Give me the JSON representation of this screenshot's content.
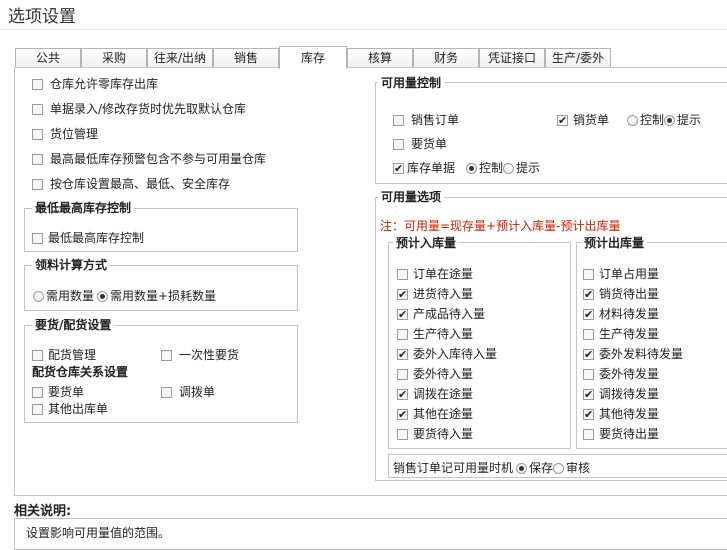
{
  "window": {
    "title": "选项设置"
  },
  "tabs": [
    "公共",
    "采购",
    "往来/出纳",
    "销售",
    "库存",
    "核算",
    "财务",
    "凭证接口",
    "生产/委外"
  ],
  "left": {
    "options": [
      {
        "label": "仓库允许零库存出库",
        "checked": false
      },
      {
        "label": "单据录入/修改存货时优先取默认仓库",
        "checked": false
      },
      {
        "label": "货位管理",
        "checked": false
      },
      {
        "label": "最高最低库存预警包含不参与可用量仓库",
        "checked": false
      },
      {
        "label": "按仓库设置最高、最低、安全库存",
        "checked": false
      }
    ],
    "stock_control": {
      "title": "最低最高库存控制",
      "option": "最低最高库存控制"
    },
    "calc_method": {
      "title": "领料计算方式",
      "opt1": "需用数量",
      "opt2": "需用数量+损耗数量"
    },
    "supply": {
      "title": "要货/配货设置",
      "distribution": "配货管理",
      "one_time": "一次性要货",
      "relation_title": "配货仓库关系设置",
      "request": "要货单",
      "transfer": "调拨单",
      "other_out": "其他出库单"
    }
  },
  "availability_control": {
    "title": "可用量控制",
    "sales_order": "销售订单",
    "sales_delivery": "销货单",
    "control": "控制",
    "prompt": "提示",
    "request": "要货单",
    "inventory_doc": "库存单据"
  },
  "availability_options": {
    "title": "可用量选项",
    "note": "注：可用量=现存量+预计入库量-预计出库量",
    "in": {
      "title": "预计入库量",
      "items": [
        {
          "label": "订单在途量",
          "checked": false
        },
        {
          "label": "进货待入量",
          "checked": true
        },
        {
          "label": "产成品待入量",
          "checked": true
        },
        {
          "label": "生产待入量",
          "checked": false
        },
        {
          "label": "委外入库待入量",
          "checked": true
        },
        {
          "label": "委外待入量",
          "checked": false
        },
        {
          "label": "调拨在途量",
          "checked": true
        },
        {
          "label": "其他在途量",
          "checked": true
        },
        {
          "label": "要货待入量",
          "checked": false
        }
      ]
    },
    "out": {
      "title": "预计出库量",
      "items": [
        {
          "label": "订单占用量",
          "checked": false
        },
        {
          "label": "销货待出量",
          "checked": true
        },
        {
          "label": "材料待发量",
          "checked": true
        },
        {
          "label": "生产待发量",
          "checked": false
        },
        {
          "label": "委外发料待发量",
          "checked": true
        },
        {
          "label": "委外待发量",
          "checked": false
        },
        {
          "label": "调拨待发量",
          "checked": true
        },
        {
          "label": "其他待发量",
          "checked": true
        },
        {
          "label": "要货待出量",
          "checked": false
        }
      ]
    },
    "timing": {
      "label": "销售订单记可用量时机",
      "save": "保存",
      "review": "审核"
    }
  },
  "description": {
    "title": "相关说明:",
    "text": "设置影响可用量值的范围。"
  }
}
